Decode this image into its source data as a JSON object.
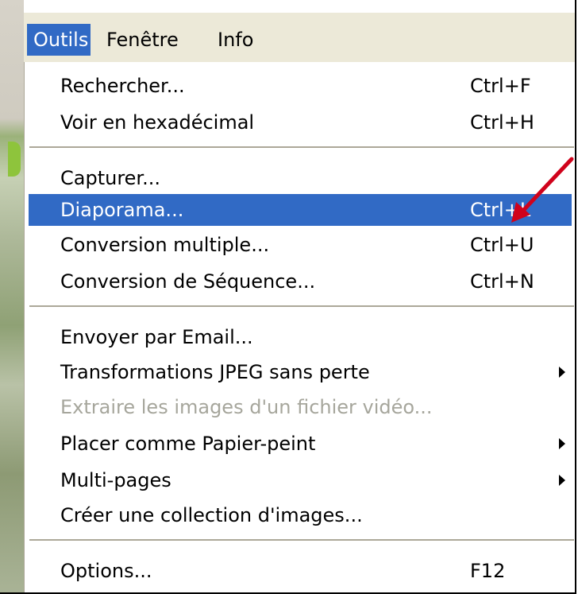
{
  "menubar": {
    "items": [
      {
        "label": "Outils",
        "active": true
      },
      {
        "label": "Fenêtre"
      },
      {
        "label": "Info"
      }
    ]
  },
  "menu": {
    "items": [
      {
        "label": "Rechercher...",
        "shortcut": "Ctrl+F"
      },
      {
        "label": "Voir en hexadécimal",
        "shortcut": "Ctrl+H"
      },
      {
        "label": "Capturer...",
        "shortcut": ""
      },
      {
        "label": "Diaporama...",
        "shortcut": "Ctrl+L",
        "highlighted": true
      },
      {
        "label": "Conversion multiple...",
        "shortcut": "Ctrl+U"
      },
      {
        "label": "Conversion de Séquence...",
        "shortcut": "Ctrl+N"
      },
      {
        "label": "Envoyer par Email...",
        "shortcut": ""
      },
      {
        "label": "Transformations JPEG sans perte",
        "shortcut": "",
        "submenu": true
      },
      {
        "label": "Extraire les images d'un fichier vidéo...",
        "shortcut": "",
        "disabled": true
      },
      {
        "label": "Placer comme Papier-peint",
        "shortcut": "",
        "submenu": true
      },
      {
        "label": "Multi-pages",
        "shortcut": "",
        "submenu": true
      },
      {
        "label": "Créer une collection d'images...",
        "shortcut": ""
      },
      {
        "label": "Options...",
        "shortcut": "F12"
      }
    ]
  },
  "colors": {
    "highlight": "#316ac5",
    "menubar_bg": "#ece9d8",
    "disabled_text": "#a6a69c",
    "annotation_arrow": "#d0021b"
  },
  "annotation": {
    "icon": "red-arrow-icon"
  }
}
